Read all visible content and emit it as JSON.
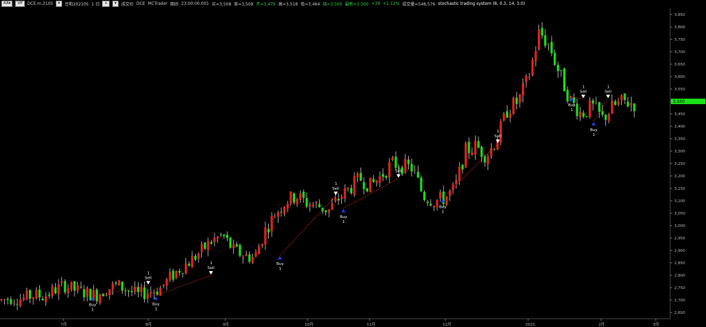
{
  "toolbar": {
    "btn_aa": "AA▾",
    "btn_vp": "VP",
    "symbol_code": "DCE.m.2105",
    "btn_minus": "▾",
    "symbol_name": "豆粕202105",
    "interval": "1 日",
    "btn_plus": "+",
    "btn_contract": "▾",
    "mode": "成交价",
    "exchange": "DCE",
    "source": "MCTrader",
    "session": "期间",
    "time": "23:00:00.001",
    "bid": "买=3,508",
    "ask": "卖=3,509",
    "open": "开=3,479",
    "high": "高=3,518",
    "low": "低=3,464",
    "settle": "结=3,500",
    "last": "最新=3,500",
    "change": "+39",
    "change_pct": "+1.12%",
    "volume": "成交量=548,576",
    "strategy": "stochastic trading system (8, 0.3, 14, 3.0)"
  },
  "price_axis": {
    "ticks": [
      "3,850",
      "3,800",
      "3,750",
      "3,700",
      "3,650",
      "3,600",
      "3,550",
      "3,500",
      "3,450",
      "3,400",
      "3,350",
      "3,300",
      "3,250",
      "3,200",
      "3,150",
      "3,100",
      "3,050",
      "3,000",
      "2,950",
      "2,900",
      "2,850",
      "2,800",
      "2,750",
      "2,700",
      "2,650"
    ],
    "current_price": "3,500"
  },
  "time_axis": {
    "labels": [
      "7月",
      "8月",
      "9月",
      "10月",
      "11月",
      "12月",
      "2021",
      "2月",
      "3月"
    ]
  },
  "signals": {
    "buy_label": "Buy",
    "sell_label": "Sell",
    "qty": "1"
  },
  "colors": {
    "up": "#e0241f",
    "down": "#19e019",
    "signal_line": "#ff2a2a",
    "buy_arrow": "#1f3fff",
    "price_tag": "#19e019"
  },
  "chart_data": {
    "type": "candlestick",
    "ylim": [
      2625,
      3875
    ],
    "price_levels": [
      2700,
      2710,
      2705,
      2720,
      2715,
      2740,
      2760,
      2740,
      2730,
      2720,
      2745,
      2760,
      2740,
      2720,
      2735,
      2745,
      2790,
      2830,
      2860,
      2900,
      2940,
      2960,
      2900,
      2880,
      2870,
      2980,
      3050,
      3100,
      3120,
      3090,
      3080,
      3060,
      3110,
      3150,
      3190,
      3160,
      3200,
      3250,
      3240,
      3230,
      3120,
      3100,
      3110,
      3150,
      3300,
      3320,
      3280,
      3350,
      3470,
      3500,
      3600,
      3780,
      3720,
      3600,
      3500,
      3450,
      3480,
      3430,
      3480,
      3500,
      3490
    ],
    "signals": [
      {
        "type": "Buy",
        "price": 2715
      },
      {
        "type": "Sell",
        "price": 2760
      },
      {
        "type": "Buy",
        "price": 2718
      },
      {
        "type": "Sell",
        "price": 2800
      },
      {
        "type": "Buy",
        "price": 2880
      },
      {
        "type": "Sell",
        "price": 3120
      },
      {
        "type": "Buy",
        "price": 3070
      },
      {
        "type": "Sell",
        "price": 3190
      },
      {
        "type": "Buy",
        "price": 3110
      },
      {
        "type": "Sell",
        "price": 3330
      },
      {
        "type": "Buy",
        "price": 3520
      },
      {
        "type": "Sell",
        "price": 3510
      },
      {
        "type": "Buy",
        "price": 3420
      },
      {
        "type": "Sell",
        "price": 3510
      }
    ]
  }
}
